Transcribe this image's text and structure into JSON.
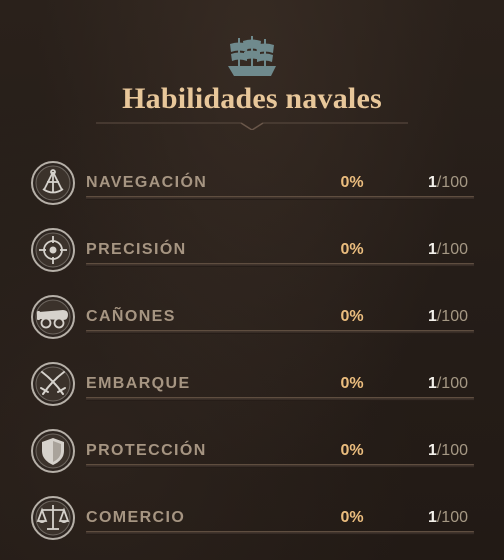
{
  "title": "Habilidades navales",
  "header_icon": "ship-icon",
  "skills": [
    {
      "name": "NAVEGACIÓN",
      "percent": "0%",
      "level": "1",
      "max": "/100",
      "icon": "sextant-icon"
    },
    {
      "name": "PRECISIÓN",
      "percent": "0%",
      "level": "1",
      "max": "/100",
      "icon": "crosshair-icon"
    },
    {
      "name": "CAÑONES",
      "percent": "0%",
      "level": "1",
      "max": "/100",
      "icon": "cannon-icon"
    },
    {
      "name": "EMBARQUE",
      "percent": "0%",
      "level": "1",
      "max": "/100",
      "icon": "crossed-swords-icon"
    },
    {
      "name": "PROTECCIÓN",
      "percent": "0%",
      "level": "1",
      "max": "/100",
      "icon": "shield-icon"
    },
    {
      "name": "COMERCIO",
      "percent": "0%",
      "level": "1",
      "max": "/100",
      "icon": "scales-icon"
    }
  ],
  "colors": {
    "title": "#e8c79a",
    "skill_name": "#a69582",
    "percent": "#ebbd7e",
    "level_current": "#f3f0ea",
    "level_max": "#a59884",
    "background": "#241c17"
  }
}
